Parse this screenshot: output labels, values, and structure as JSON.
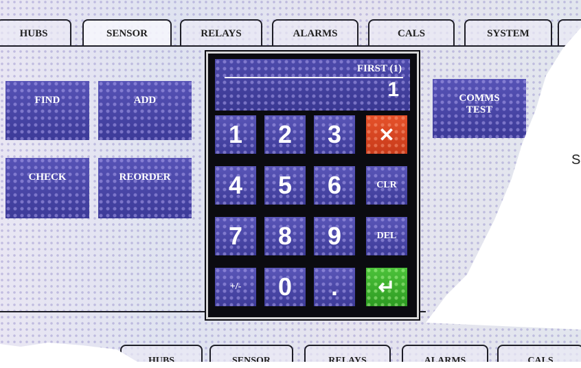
{
  "tabs": [
    "HUBS",
    "SENSOR",
    "RELAYS",
    "ALARMS",
    "CALS",
    "SYSTEM",
    ""
  ],
  "active_tab": "SENSOR",
  "buttons": {
    "find": "FIND",
    "add": "ADD",
    "check": "CHECK",
    "reorder": "REORDER",
    "comms_line1": "COMMS",
    "comms_line2": "TEST"
  },
  "keypad": {
    "label": "FIRST (1)",
    "value": "1",
    "keys": [
      "1",
      "2",
      "3",
      "✕",
      "4",
      "5",
      "6",
      "CLR",
      "7",
      "8",
      "9",
      "DEL",
      "+/-",
      "0",
      ".",
      "↵"
    ]
  },
  "stray_text": "S",
  "bottom_tabs": [
    "HUBS",
    "SENSOR",
    "RELAYS",
    "ALARMS",
    "CALS"
  ],
  "colors": {
    "button_blue": "#4a47aa",
    "cancel_red": "#d94522",
    "enter_green": "#3fae2e"
  }
}
